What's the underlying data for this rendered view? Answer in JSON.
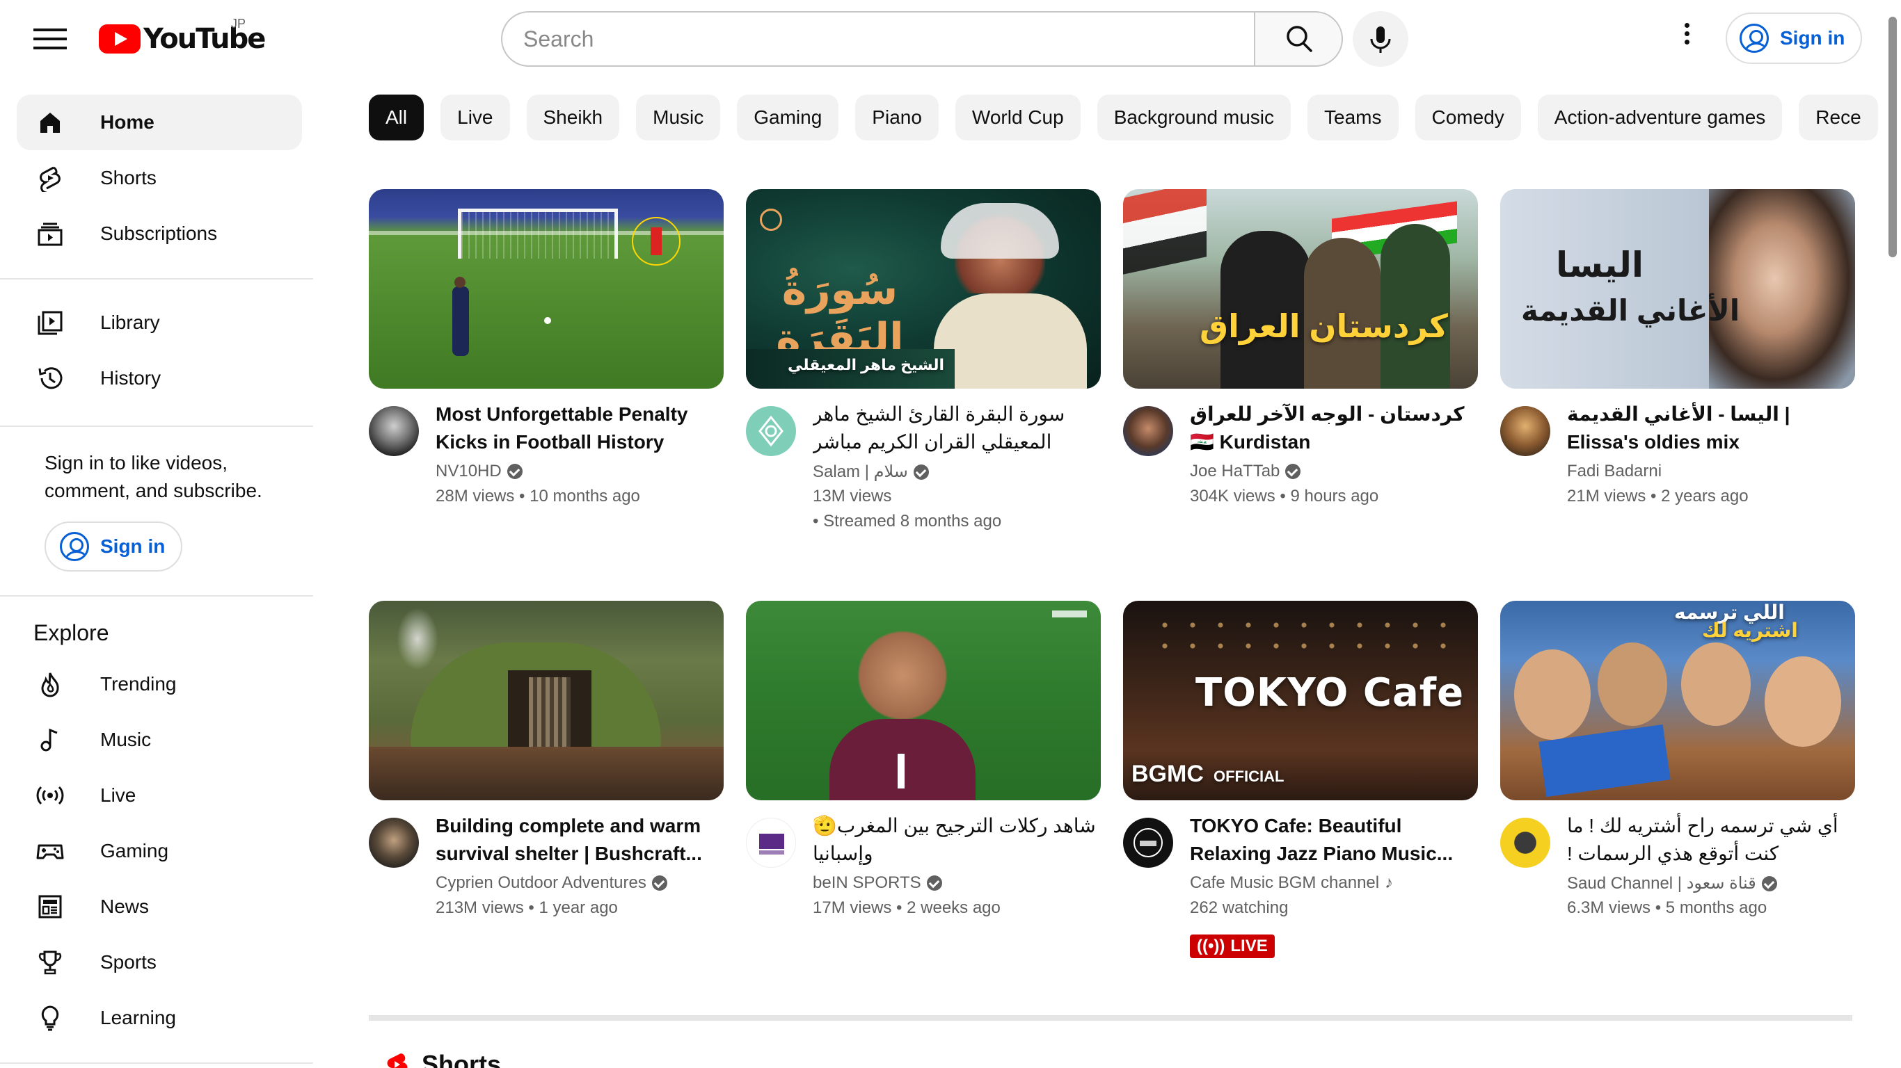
{
  "header": {
    "logo_text": "YouTube",
    "region": "JP",
    "search_placeholder": "Search",
    "sign_in_label": "Sign in"
  },
  "sidebar": {
    "primary": [
      {
        "label": "Home",
        "icon": "home-icon",
        "active": true
      },
      {
        "label": "Shorts",
        "icon": "shorts-icon"
      },
      {
        "label": "Subscriptions",
        "icon": "subscriptions-icon"
      }
    ],
    "secondary": [
      {
        "label": "Library",
        "icon": "library-icon"
      },
      {
        "label": "History",
        "icon": "history-icon"
      }
    ],
    "sign_in_prompt": "Sign in to like videos, comment, and subscribe.",
    "sign_in_label": "Sign in",
    "explore_heading": "Explore",
    "explore": [
      {
        "label": "Trending",
        "icon": "trending-icon"
      },
      {
        "label": "Music",
        "icon": "music-icon"
      },
      {
        "label": "Live",
        "icon": "live-icon"
      },
      {
        "label": "Gaming",
        "icon": "gaming-icon"
      },
      {
        "label": "News",
        "icon": "news-icon"
      },
      {
        "label": "Sports",
        "icon": "sports-icon"
      },
      {
        "label": "Learning",
        "icon": "learning-icon"
      }
    ]
  },
  "chips": [
    "All",
    "Live",
    "Sheikh",
    "Music",
    "Gaming",
    "Piano",
    "World Cup",
    "Background music",
    "Teams",
    "Comedy",
    "Action-adventure games",
    "Rece"
  ],
  "videos": [
    {
      "title": "Most Unforgettable Penalty Kicks in Football History",
      "channel": "NV10HD",
      "verified": true,
      "views": "28M views",
      "age": "10 months ago"
    },
    {
      "title": "سورة البقرة القارئ الشيخ ماهر المعيقلي القران الكريم مباشر Surat Al-...",
      "channel": "Salam | سلام",
      "verified": true,
      "views": "13M views",
      "age": "Streamed 8 months ago",
      "thumb_title": "سُورَةُ البَقَرَة",
      "thumb_subtitle": "الشيخ ماهر المعيقلي"
    },
    {
      "title": "كردستان - الوجه الآخر للعراق 🇮🇶 Kurdistan",
      "channel": "Joe HaTTab",
      "verified": true,
      "views": "304K views",
      "age": "9 hours ago",
      "thumb_title": "كردستان العراق"
    },
    {
      "title": "اليسا - الأغاني القديمة | Elissa's oldies mix",
      "channel": "Fadi Badarni",
      "verified": false,
      "views": "21M views",
      "age": "2 years ago",
      "thumb_title": "اليسا",
      "thumb_subtitle": "الأغاني القديمة"
    },
    {
      "title": "Building complete and warm survival shelter | Bushcraft...",
      "channel": "Cyprien Outdoor Adventures",
      "verified": true,
      "views": "213M views",
      "age": "1 year ago"
    },
    {
      "title": "شاهد ركلات الترجيح بين المغرب🫡 وإسبانيا",
      "channel": "beIN SPORTS",
      "verified": true,
      "views": "17M views",
      "age": "2 weeks ago"
    },
    {
      "title": "TOKYO Cafe: Beautiful Relaxing Jazz Piano Music...",
      "channel": "Cafe Music BGM channel",
      "verified": false,
      "music_note": true,
      "views": "262 watching",
      "age": "",
      "live": true,
      "live_label": "LIVE",
      "thumb_title": "TOKYO Cafe",
      "thumb_brand": "BGMC",
      "thumb_brand_sub": "OFFICIAL"
    },
    {
      "title": "أي شي ترسمه راح أشتريه لك ! ما كنت أتوقع هذي الرسمات !",
      "channel": "Saud Channel | قناة سعود",
      "verified": true,
      "views": "6.3M views",
      "age": "5 months ago",
      "thumb_title": "اللي ترسمه",
      "thumb_subtitle": "اشتريه لك"
    }
  ],
  "shorts_heading": "Shorts",
  "colors": {
    "brand_red": "#ff0000",
    "link_blue": "#065fd4",
    "chip_bg": "#f2f2f2",
    "chip_active_bg": "#0f0f0f",
    "live_red": "#cc0000"
  }
}
